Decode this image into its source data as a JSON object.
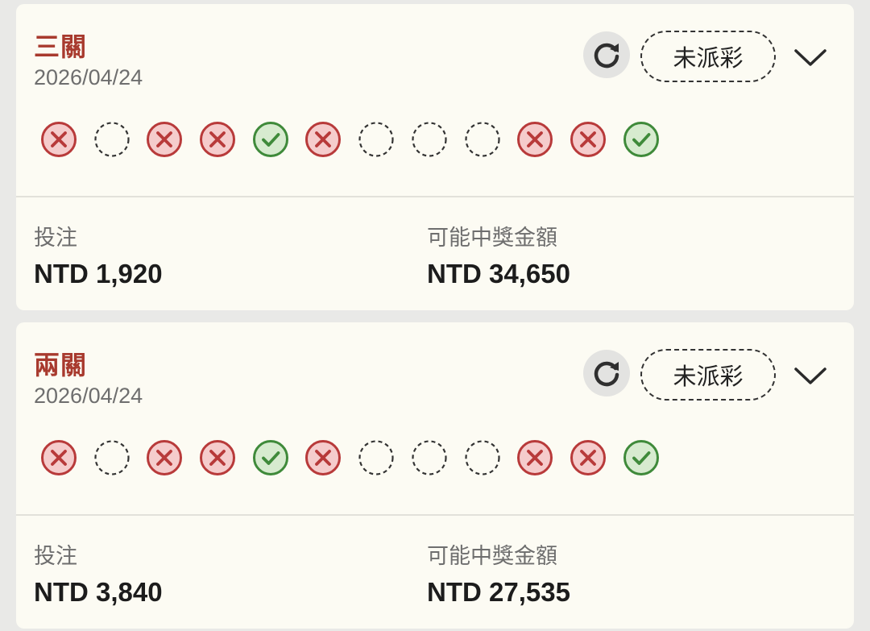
{
  "bets": [
    {
      "title": "三關",
      "date": "2026/04/24",
      "status": "未派彩",
      "legs": [
        "lost",
        "pending",
        "lost",
        "lost",
        "won",
        "lost",
        "pending",
        "pending",
        "pending",
        "lost",
        "lost",
        "won"
      ],
      "stake_label": "投注",
      "stake_value": "NTD 1,920",
      "payout_label": "可能中獎金額",
      "payout_value": "NTD 34,650"
    },
    {
      "title": "兩關",
      "date": "2026/04/24",
      "status": "未派彩",
      "legs": [
        "lost",
        "pending",
        "lost",
        "lost",
        "won",
        "lost",
        "pending",
        "pending",
        "pending",
        "lost",
        "lost",
        "won"
      ],
      "stake_label": "投注",
      "stake_value": "NTD 3,840",
      "payout_label": "可能中獎金額",
      "payout_value": "NTD 27,535"
    }
  ],
  "icons": {
    "refresh": "refresh-icon",
    "expand": "chevron-down-icon",
    "lost": "lost-x-icon",
    "won": "won-check-icon",
    "pending": "pending-dashed-circle-icon"
  },
  "colors": {
    "title": "#a83a2e",
    "lost": "#b83a3a",
    "won": "#3f8a3a",
    "card_bg": "#fcfbf3",
    "page_bg": "#e9e9e7"
  }
}
